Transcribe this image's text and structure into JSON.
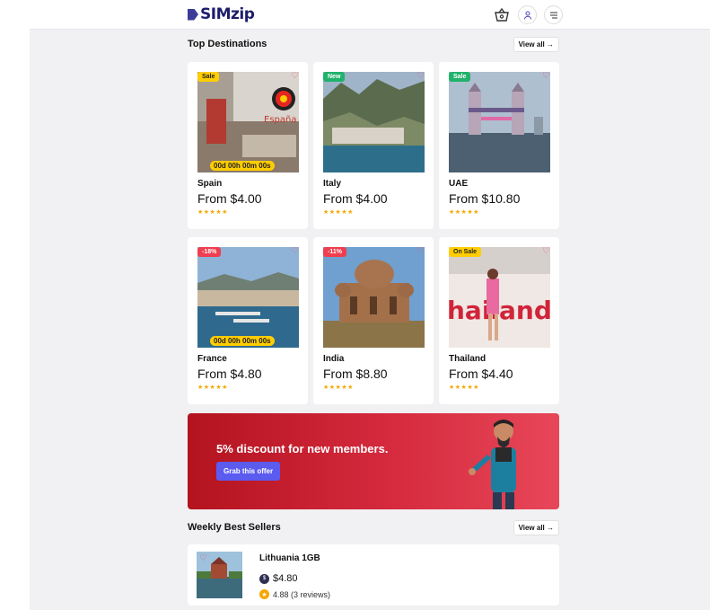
{
  "header": {
    "logo_text": "SIMzip"
  },
  "top_destinations": {
    "title": "Top Destinations",
    "view_all": "View all →",
    "cards": [
      {
        "name": "Spain",
        "price": "From $4.00",
        "badge": "Sale",
        "badge_color": "#ffcd00",
        "timer": "00d 00h 00m 00s",
        "stars": "★★★★★"
      },
      {
        "name": "Italy",
        "price": "From $4.00",
        "badge": "New",
        "badge_color": "#20b26b",
        "stars": "★★★★★"
      },
      {
        "name": "UAE",
        "price": "From $10.80",
        "badge": "Sale",
        "badge_color": "#20b26b",
        "stars": "★★★★★"
      },
      {
        "name": "France",
        "price": "From $4.80",
        "badge": "-18%",
        "badge_color": "#ef3e4f",
        "timer": "00d 00h 00m 00s",
        "stars": "★★★★★"
      },
      {
        "name": "India",
        "price": "From $8.80",
        "badge": "-11%",
        "badge_color": "#ef3e4f",
        "stars": "★★★★★"
      },
      {
        "name": "Thailand",
        "price": "From $4.40",
        "badge": "On Sale",
        "badge_color": "#ffcd00",
        "stars": "★★★★★"
      }
    ]
  },
  "banner": {
    "title": "5% discount for new members.",
    "button": "Grab this offer"
  },
  "weekly_best": {
    "title": "Weekly Best Sellers",
    "view_all": "View all →",
    "item": {
      "name": "Lithuania 1GB",
      "price": "$4.80",
      "rating": "4.88 (3 reviews)"
    }
  }
}
